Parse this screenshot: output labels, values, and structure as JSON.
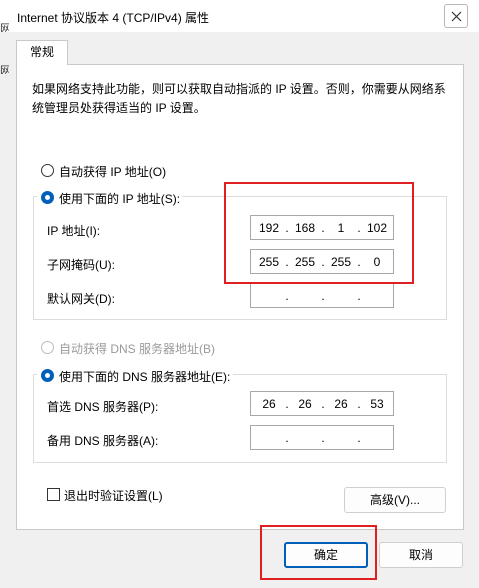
{
  "window": {
    "title": "Internet 协议版本 4 (TCP/IPv4) 属性",
    "left_edge_fragment": "网"
  },
  "tabs": [
    {
      "label": "常规"
    }
  ],
  "description": "如果网络支持此功能，则可以获取自动指派的 IP 设置。否则，你需要从网络系统管理员处获得适当的 IP 设置。",
  "ip_settings": {
    "auto_label": "自动获得 IP 地址(O)",
    "auto_selected": false,
    "manual_label": "使用下面的 IP 地址(S):",
    "manual_selected": true,
    "ip_address": {
      "label": "IP 地址(I):",
      "octets": [
        "192",
        "168",
        "1",
        "102"
      ]
    },
    "subnet_mask": {
      "label": "子网掩码(U):",
      "octets": [
        "255",
        "255",
        "255",
        "0"
      ]
    },
    "default_gateway": {
      "label": "默认网关(D):",
      "octets": [
        "",
        "",
        "",
        ""
      ]
    }
  },
  "dns_settings": {
    "auto_label": "自动获得 DNS 服务器地址(B)",
    "auto_enabled": false,
    "manual_label": "使用下面的 DNS 服务器地址(E):",
    "manual_selected": true,
    "preferred": {
      "label": "首选 DNS 服务器(P):",
      "octets": [
        "26",
        "26",
        "26",
        "53"
      ]
    },
    "alternate": {
      "label": "备用 DNS 服务器(A):",
      "octets": [
        "",
        "",
        "",
        ""
      ]
    }
  },
  "validate_on_exit": {
    "label": "退出时验证设置(L)",
    "checked": false
  },
  "buttons": {
    "advanced": "高级(V)...",
    "ok": "确定",
    "cancel": "取消"
  },
  "colors": {
    "accent": "#005fb8",
    "annotation": "#e02020"
  }
}
